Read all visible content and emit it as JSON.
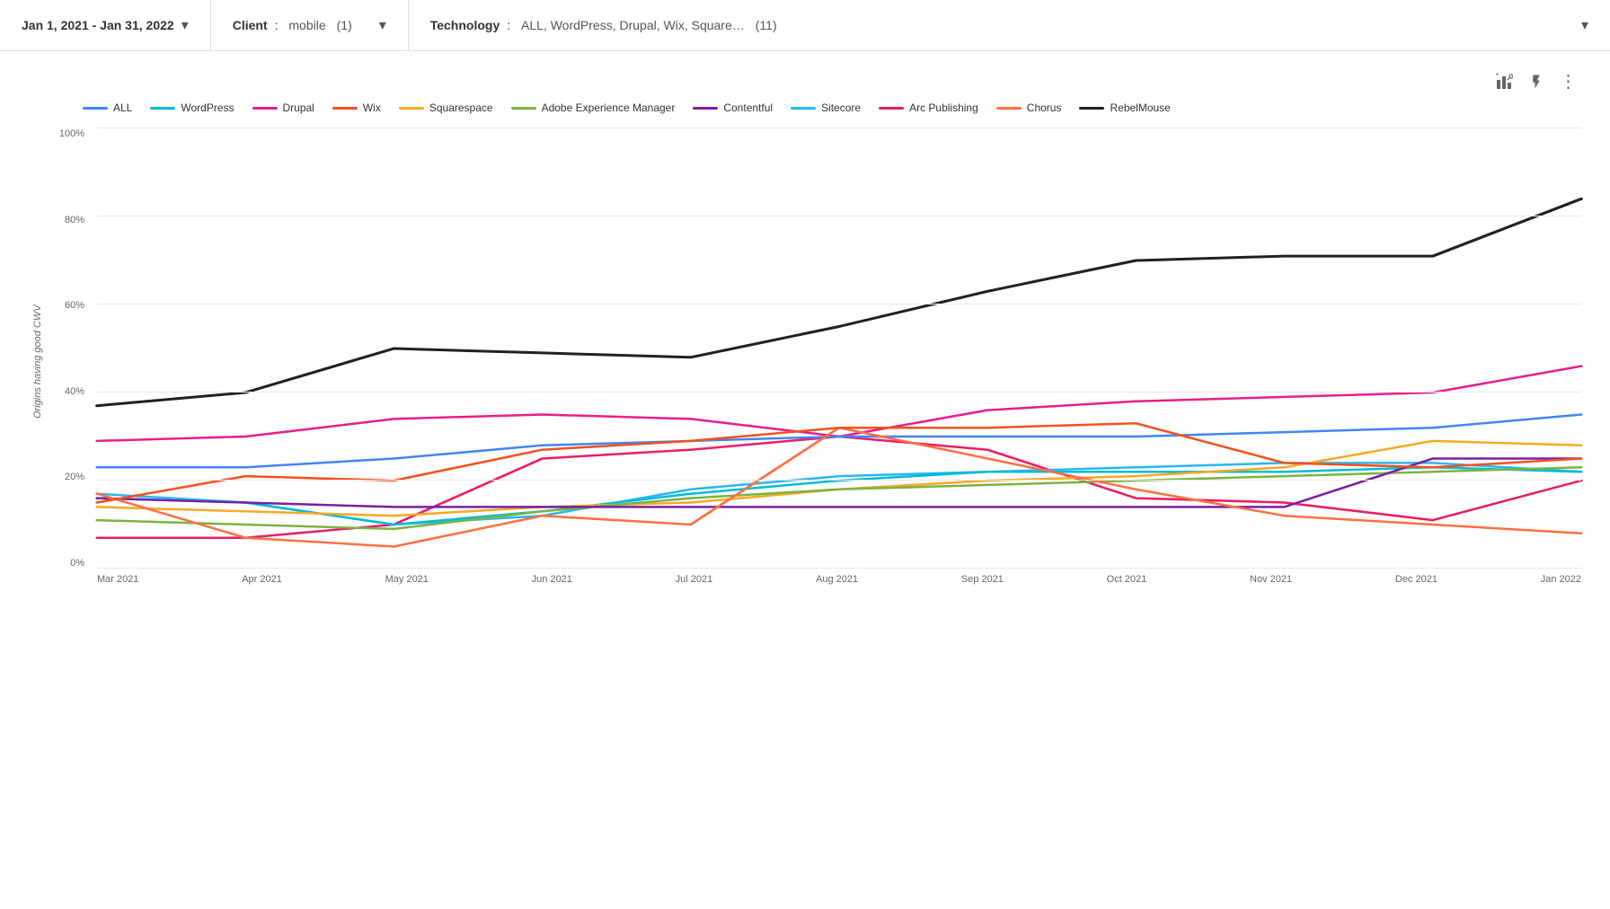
{
  "filters": {
    "date": {
      "label": "Jan 1, 2021 - Jan 31, 2022"
    },
    "client": {
      "label": "Client",
      "value": "mobile",
      "count": "(1)"
    },
    "technology": {
      "label": "Technology",
      "value": "ALL, WordPress, Drupal, Wix, Square…",
      "count": "(11)"
    }
  },
  "toolbar": {
    "chart_icon": "⊞",
    "lightning_icon": "⚡",
    "more_icon": "⋮"
  },
  "legend": [
    {
      "id": "all",
      "label": "ALL",
      "color": "#4285F4",
      "dash": false
    },
    {
      "id": "wordpress",
      "label": "WordPress",
      "color": "#00BCD4",
      "dash": false
    },
    {
      "id": "drupal",
      "label": "Drupal",
      "color": "#E91E8C",
      "dash": false
    },
    {
      "id": "wix",
      "label": "Wix",
      "color": "#F4511E",
      "dash": false
    },
    {
      "id": "squarespace",
      "label": "Squarespace",
      "color": "#F9A825",
      "dash": false
    },
    {
      "id": "aem",
      "label": "Adobe Experience Manager",
      "color": "#7CB342",
      "dash": false
    },
    {
      "id": "contentful",
      "label": "Contentful",
      "color": "#7B1FA2",
      "dash": false
    },
    {
      "id": "sitecore",
      "label": "Sitecore",
      "color": "#29B6F6",
      "dash": false
    },
    {
      "id": "arc",
      "label": "Arc Publishing",
      "color": "#E91E63",
      "dash": false
    },
    {
      "id": "chorus",
      "label": "Chorus",
      "color": "#FF7043",
      "dash": false
    },
    {
      "id": "rebelmouse",
      "label": "RebelMouse",
      "color": "#212121",
      "dash": false
    }
  ],
  "y_axis": {
    "ticks": [
      "0%",
      "20%",
      "40%",
      "60%",
      "80%",
      "100%"
    ]
  },
  "x_axis": {
    "ticks": [
      "Mar 2021",
      "Apr 2021",
      "May 2021",
      "Jun 2021",
      "Jul 2021",
      "Aug 2021",
      "Sep 2021",
      "Oct 2021",
      "Nov 2021",
      "Dec 2021",
      "Jan 2022"
    ]
  },
  "chart": {
    "y_label": "Origins having good CWV"
  }
}
